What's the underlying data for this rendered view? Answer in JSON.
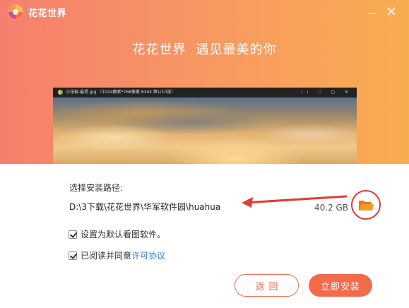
{
  "window": {
    "title": "花花世界",
    "slogan_part1": "花花世界",
    "slogan_part2": "遇见最美的你"
  },
  "preview": {
    "caption": "小花椒-最受.jpg （1024像素*768像素 634k 第1/10张）",
    "controls": "⁞⁞ ⛶ ▢ ✕"
  },
  "install": {
    "path_label": "选择安装路径:",
    "path_value": "D:\\3下载\\花花世界\\华军软件园\\huahua",
    "size": "40.2 GB"
  },
  "options": {
    "default_viewer": {
      "label": "设置为默认看图软件。",
      "checked": true
    },
    "agreement": {
      "label": "已阅读并同意",
      "link": "许可协议",
      "checked": true
    }
  },
  "buttons": {
    "back": "返回",
    "install": "立即安装"
  },
  "colors": {
    "accent": "#f26b4b",
    "header_start": "#f57f6d",
    "header_end": "#f8ad50",
    "highlight_red": "#e53935",
    "link": "#3a7ad8"
  },
  "icons": {
    "logo": "app-logo",
    "minimize": "minimize-icon",
    "close": "close-icon",
    "folder": "folder-icon"
  }
}
